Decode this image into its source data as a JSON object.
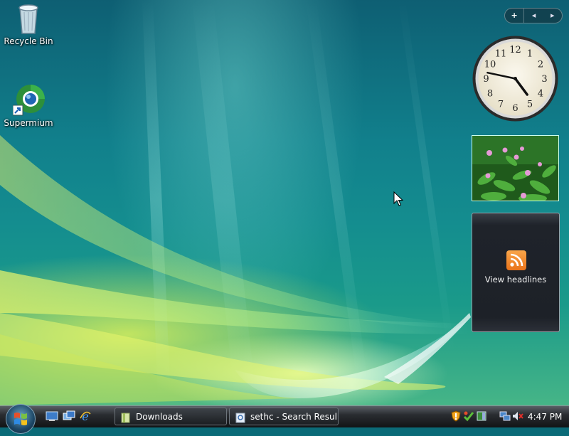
{
  "desktop": {
    "icons": [
      {
        "label": "Recycle Bin"
      },
      {
        "label": "Supermium"
      }
    ]
  },
  "sidebar": {
    "controls": {
      "add": "+",
      "prev": "◂",
      "next": "▸"
    },
    "clock": {
      "numerals": [
        "12",
        "1",
        "2",
        "3",
        "4",
        "5",
        "6",
        "7",
        "8",
        "9",
        "10",
        "11"
      ],
      "time_shown": "4:47"
    },
    "feed": {
      "label": "View headlines"
    }
  },
  "taskbar": {
    "tasks": [
      {
        "label": "Downloads"
      },
      {
        "label": "sethc - Search Resul..."
      }
    ],
    "clock": "4:47 PM"
  },
  "colors": {
    "accent": "#1a9a8a",
    "taskbar": "#2a2d31",
    "rss": "#f28b2a"
  }
}
